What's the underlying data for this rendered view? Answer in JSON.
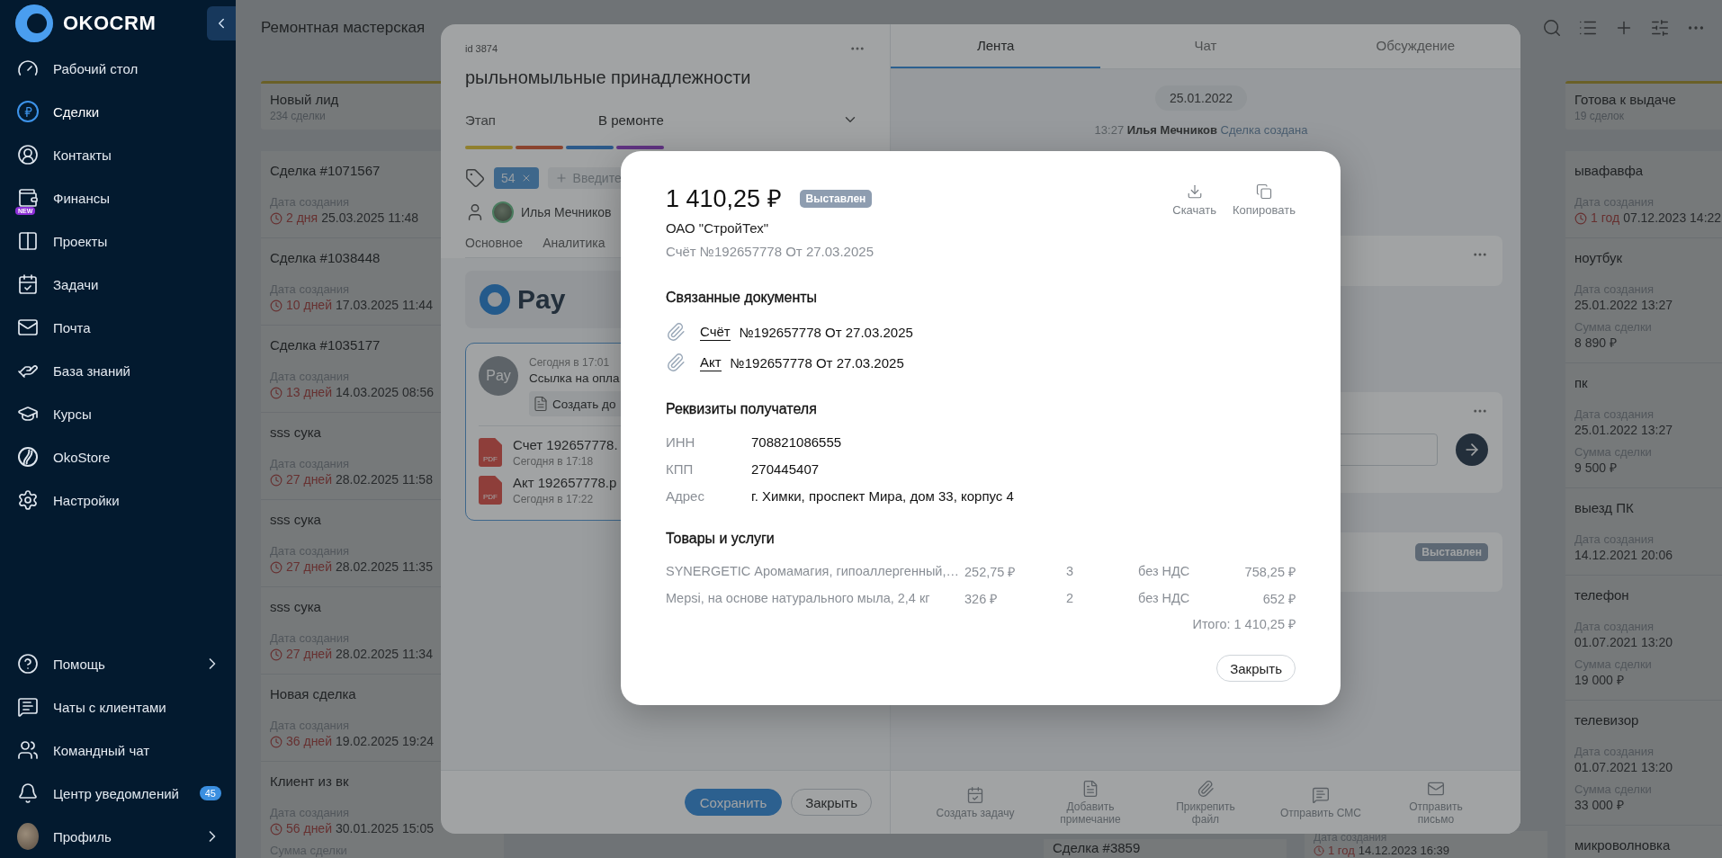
{
  "sidebar": {
    "logo": "OKOCRM",
    "items": [
      {
        "label": "Рабочий стол",
        "selected": false
      },
      {
        "label": "Сделки",
        "selected": true
      },
      {
        "label": "Контакты",
        "selected": false
      },
      {
        "label": "Финансы",
        "selected": false,
        "badge": "NEW"
      },
      {
        "label": "Проекты",
        "selected": false
      },
      {
        "label": "Задачи",
        "selected": false
      },
      {
        "label": "Почта",
        "selected": false
      },
      {
        "label": "База знаний",
        "selected": false
      },
      {
        "label": "Курсы",
        "selected": false
      },
      {
        "label": "OkoStore",
        "selected": false
      },
      {
        "label": "Настройки",
        "selected": false
      }
    ],
    "bottom_items": [
      {
        "label": "Помощь",
        "has_submenu": true
      },
      {
        "label": "Чаты с клиентами",
        "has_submenu": false
      },
      {
        "label": "Командный чат",
        "has_submenu": false
      },
      {
        "label": "Центр уведомлений",
        "has_submenu": false,
        "count": "45"
      },
      {
        "label": "Профиль",
        "has_submenu": true
      }
    ]
  },
  "board": {
    "title": "Ремонтная мастерская",
    "left_column": {
      "title": "Новый лид",
      "count": "234 сделки",
      "cards": [
        {
          "title": "Сделка #1071567",
          "date_label": "Дата создания",
          "age": "2 дня",
          "date": "25.03.2025 11:48"
        },
        {
          "title": "Сделка #1038448",
          "date_label": "Дата создания",
          "age": "10 дней",
          "date": "17.03.2025 11:44"
        },
        {
          "title": "Сделка #1035177",
          "date_label": "Дата создания",
          "age": "13 дней",
          "date": "14.03.2025 08:56"
        },
        {
          "title": "sss сука",
          "date_label": "Дата создания",
          "age": "27 дней",
          "date": "28.02.2025 11:58"
        },
        {
          "title": "sss сука",
          "date_label": "Дата создания",
          "age": "27 дней",
          "date": "28.02.2025 11:35"
        },
        {
          "title": "sss сука",
          "date_label": "Дата создания",
          "age": "27 дней",
          "date": "28.02.2025 11:34"
        },
        {
          "title": "Новая сделка",
          "date_label": "Дата создания",
          "age": "36 дней",
          "date": "19.02.2025 19:24"
        },
        {
          "title": "Клиент из вк",
          "date_label": "Дата создания",
          "age": "56 дней",
          "date": "30.01.2025 15:05",
          "sum_label": "Сумма сделки"
        }
      ]
    },
    "bottom_peeks": [
      {
        "title": "Сделка #3859"
      },
      {
        "date_label": "Дата создания",
        "age": "1 год",
        "date": "14.12.2023 16:39"
      }
    ],
    "right_column": {
      "title": "Готова к выдаче",
      "count": "19 сделок",
      "cards": [
        {
          "title": "ывафавфа",
          "date_label": "Дата создания",
          "age": "1 год",
          "date": "07.12.2023 14:22"
        },
        {
          "title": "ноутбук",
          "date_label": "Дата создания",
          "date": "25.01.2022 13:27",
          "sum_label": "Сумма сделки",
          "sum": "8 890 ₽"
        },
        {
          "title": "пк",
          "date_label": "Дата создания",
          "date": "25.01.2022 13:27",
          "sum_label": "Сумма сделки",
          "sum": "9 500 ₽"
        },
        {
          "title": "выезд ПК",
          "date_label": "Дата создания",
          "date": "14.12.2021 20:06"
        },
        {
          "title": "телефон",
          "date_label": "Дата создания",
          "date": "01.07.2021 13:20",
          "sum_label": "Сумма сделки",
          "sum": "19 000 ₽"
        },
        {
          "title": "телевизор",
          "date_label": "Дата создания",
          "date": "01.07.2021 13:20",
          "sum_label": "Сумма сделки",
          "sum": "33 000 ₽"
        },
        {
          "title": "микроволновка"
        }
      ]
    }
  },
  "deal": {
    "id": "id 3874",
    "title": "рыльномыльные принадлежности",
    "stage_label": "Этап",
    "stage": "В ремонте",
    "tags": [
      "54"
    ],
    "tag_placeholder": "Введите",
    "responsible": "Илья Мечников",
    "tabs": [
      "Основное",
      "Аналитика"
    ],
    "pay_logo": "Pay",
    "message": {
      "avatar": "Pay",
      "time": "Сегодня в 17:01",
      "text": "Ссылка на опла",
      "action": "Создать до",
      "files": [
        {
          "type": "PDF",
          "name": "Счет 192657778.",
          "time": "Сегодня в 17:18"
        },
        {
          "type": "PDF",
          "name": "Акт 192657778.p",
          "time": "Сегодня в 17:22"
        }
      ]
    },
    "footer_buttons": [
      {
        "label": "Сохранить",
        "kind": "primary"
      },
      {
        "label": "Закрыть",
        "kind": "secondary"
      }
    ]
  },
  "feed": {
    "tabs": [
      {
        "label": "Лента",
        "selected": true
      },
      {
        "label": "Чат",
        "selected": false
      },
      {
        "label": "Обсуждение",
        "selected": false
      }
    ],
    "date": "25.01.2022",
    "event": {
      "time": "13:27",
      "author": "Илья Мечников",
      "text": "Сделка создана"
    },
    "invoice_status": "Выставлен",
    "actions": [
      "Создать задачу",
      "Добавить примечание",
      "Прикрепить файл",
      "Отправить СМС",
      "Отправить письмо"
    ]
  },
  "invoice": {
    "amount": "1 410,25 ₽",
    "status": "Выставлен",
    "company": "ОАО \"СтройТех\"",
    "number": "Счёт №192657778 От 27.03.2025",
    "actions": [
      "Скачать",
      "Копировать"
    ],
    "documents_title": "Связанные документы",
    "documents": [
      {
        "link": "Счёт",
        "text": "№192657778 От 27.03.2025"
      },
      {
        "link": "Акт",
        "text": "№192657778 От 27.03.2025"
      }
    ],
    "requisites_title": "Реквизиты получателя",
    "requisites": [
      {
        "label": "ИНН",
        "value": "708821086555"
      },
      {
        "label": "КПП",
        "value": "270445407"
      },
      {
        "label": "Адрес",
        "value": "г. Химки, проспект Мира, дом 33, корпус 4"
      }
    ],
    "goods_title": "Товары и услуги",
    "goods": [
      {
        "name": "SYNERGETIC Аромамагия, гипоаллергенный,…",
        "price": "252,75 ₽",
        "qty": "3",
        "vat": "без НДС",
        "total": "758,25 ₽"
      },
      {
        "name": "Mepsi, на основе натурального мыла, 2,4 кг",
        "price": "326 ₽",
        "qty": "2",
        "vat": "без НДС",
        "total": "652 ₽"
      }
    ],
    "total": "Итого: 1 410,25 ₽",
    "close": "Закрыть"
  }
}
